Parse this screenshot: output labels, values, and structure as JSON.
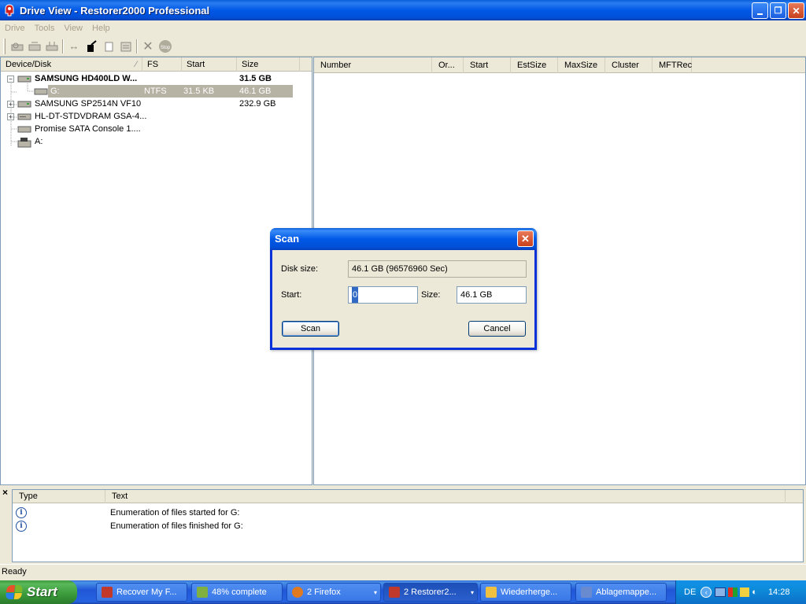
{
  "window": {
    "title": "Drive View - Restorer2000 Professional",
    "controls": [
      "minimize",
      "restore",
      "close"
    ]
  },
  "menu": {
    "items": [
      "Drive",
      "Tools",
      "View",
      "Help"
    ]
  },
  "left_pane": {
    "columns": [
      "Device/Disk",
      "FS",
      "Start",
      "Size"
    ],
    "sort_indicator": "⁄",
    "rows": [
      {
        "name": "SAMSUNG HD400LD W...",
        "fs": "",
        "start": "",
        "size": "31.5 GB",
        "expander": "−"
      },
      {
        "name": "G:",
        "fs": "NTFS",
        "start": "31.5 KB",
        "size": "46.1 GB",
        "expander": ""
      },
      {
        "name": "SAMSUNG SP2514N VF10",
        "fs": "",
        "start": "",
        "size": "232.9 GB",
        "expander": "+"
      },
      {
        "name": "HL-DT-STDVDRAM GSA-4...",
        "fs": "",
        "start": "",
        "size": "",
        "expander": "+"
      },
      {
        "name": "Promise SATA Console 1....",
        "fs": "",
        "start": "",
        "size": "",
        "expander": ""
      },
      {
        "name": "A:",
        "fs": "",
        "start": "",
        "size": "",
        "expander": ""
      }
    ]
  },
  "right_pane": {
    "columns": [
      "Number",
      "Or...",
      "Start",
      "EstSize",
      "MaxSize",
      "Cluster",
      "MFTRec"
    ]
  },
  "log": {
    "close_symbol": "×",
    "columns": [
      "Type",
      "Text"
    ],
    "rows": [
      {
        "type_icon": "i",
        "text": "Enumeration of files started for G:"
      },
      {
        "type_icon": "i",
        "text": "Enumeration of files finished for G:"
      }
    ]
  },
  "status": {
    "text": "Ready"
  },
  "dialog": {
    "title": "Scan",
    "disk_size_label": "Disk size:",
    "disk_size_value": "46.1 GB (96576960 Sec)",
    "start_label": "Start:",
    "start_value": "0",
    "size_label": "Size:",
    "size_value": "46.1 GB",
    "scan_button": "Scan",
    "cancel_button": "Cancel",
    "close_symbol": "✕"
  },
  "taskbar": {
    "start_label": "Start",
    "tasks": [
      {
        "label": "Recover My F...",
        "icon_color": "#c0392b"
      },
      {
        "label": "48% complete",
        "icon_color": "#7fb040"
      },
      {
        "label": "2 Firefox",
        "icon_color": "#e07a20"
      },
      {
        "label": "2 Restorer2...",
        "icon_color": "#c0392b"
      },
      {
        "label": "Wiederherge...",
        "icon_color": "#f0c040"
      },
      {
        "label": "Ablagemappe...",
        "icon_color": "#6a8ad0"
      }
    ],
    "tray": {
      "language": "DE",
      "clock": "14:28"
    }
  },
  "colors": {
    "title_blue": "#0058e6",
    "selection_gray": "#b6b2a4",
    "start_green": "#3a9a3a"
  }
}
